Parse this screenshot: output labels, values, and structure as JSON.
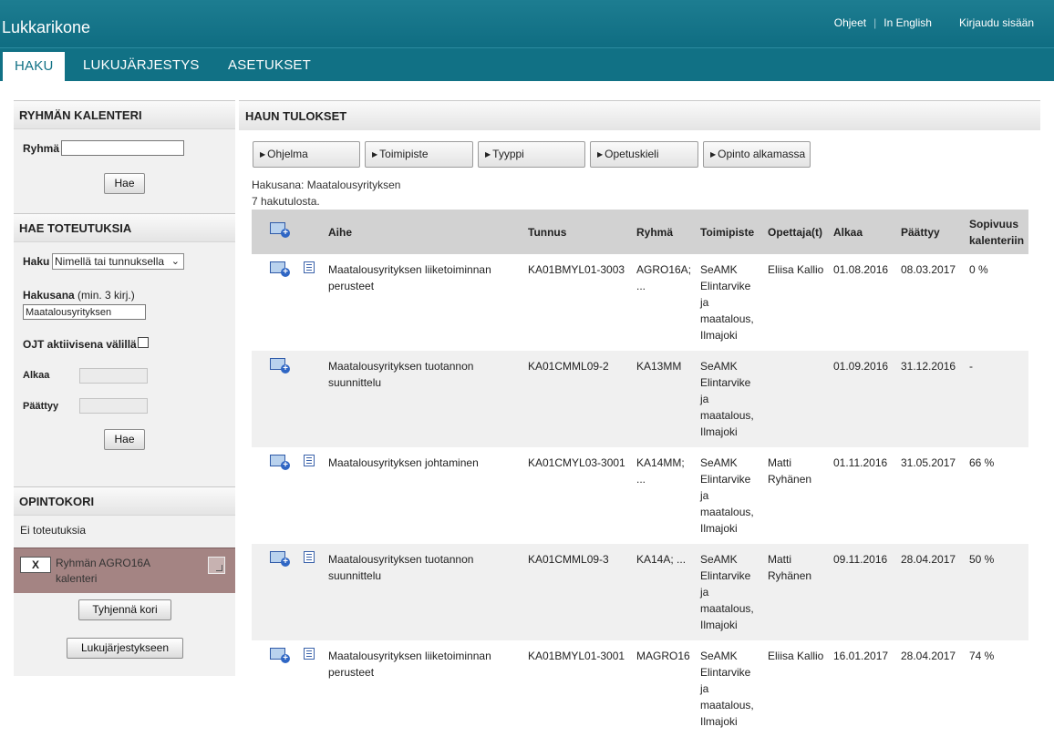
{
  "header": {
    "app_title": "Lukkarikone",
    "links": {
      "help": "Ohjeet",
      "separator": "|",
      "english": "In English",
      "login": "Kirjaudu sisään"
    }
  },
  "tabs": [
    {
      "label": "HAKU",
      "active": true
    },
    {
      "label": "LUKUJÄRJESTYS",
      "active": false
    },
    {
      "label": "ASETUKSET",
      "active": false
    }
  ],
  "sidebar": {
    "group_calendar": {
      "title": "RYHMÄN KALENTERI",
      "group_label": "Ryhmä",
      "group_value": "",
      "search_button": "Hae"
    },
    "find_implementations": {
      "title": "HAE TOTEUTUKSIA",
      "search_label": "Haku",
      "search_mode": "Nimellä tai tunnuksella",
      "query_label": "Hakusana",
      "query_hint": "(min. 3 kirj.)",
      "query_value": "Maatalousyrityksen",
      "ojt_label": "OJT aktiivisena välillä",
      "ojt_checked": false,
      "start_label": "Alkaa",
      "end_label": "Päättyy",
      "search_button": "Hae"
    },
    "cart": {
      "title": "OPINTOKORI",
      "empty_text": "Ei toteutuksia",
      "item_remove": "X",
      "item_label": "Ryhmän AGRO16A kalenteri",
      "clear_button": "Tyhjennä kori",
      "to_schedule_button": "Lukujärjestykseen"
    }
  },
  "results": {
    "title": "HAUN TULOKSET",
    "filters": [
      "Ohjelma",
      "Toimipiste",
      "Tyyppi",
      "Opetuskieli",
      "Opinto alkamassa"
    ],
    "search_term_text": "Hakusana: Maatalousyrityksen",
    "count_text": "7 hakutulosta.",
    "columns": {
      "subject": "Aihe",
      "code": "Tunnus",
      "group": "Ryhmä",
      "location": "Toimipiste",
      "teachers": "Opettaja(t)",
      "start": "Alkaa",
      "end": "Päättyy",
      "fit_line1": "Sopivuus",
      "fit_line2": "kalenteriin"
    },
    "rows": [
      {
        "subject": "Maatalousyrityksen liiketoiminnan perusteet",
        "code": "KA01BMYL01-3003",
        "group": "AGRO16A; ...",
        "location": "SeAMK Elintarvike ja maatalous, Ilmajoki",
        "teachers": "Eliisa Kallio",
        "start": "01.08.2016",
        "end": "08.03.2017",
        "fit": "0 %",
        "has_details": true
      },
      {
        "subject": "Maatalousyrityksen tuotannon suunnittelu",
        "code": "KA01CMML09-2",
        "group": "KA13MM",
        "location": "SeAMK Elintarvike ja maatalous, Ilmajoki",
        "teachers": "",
        "start": "01.09.2016",
        "end": "31.12.2016",
        "fit": "-",
        "has_details": false
      },
      {
        "subject": "Maatalousyrityksen johtaminen",
        "code": "KA01CMYL03-3001",
        "group": "KA14MM; ...",
        "location": "SeAMK Elintarvike ja maatalous, Ilmajoki",
        "teachers": "Matti Ryhänen",
        "start": "01.11.2016",
        "end": "31.05.2017",
        "fit": "66 %",
        "has_details": true
      },
      {
        "subject": "Maatalousyrityksen tuotannon suunnittelu",
        "code": "KA01CMML09-3",
        "group": "KA14A; ...",
        "location": "SeAMK Elintarvike ja maatalous, Ilmajoki",
        "teachers": "Matti Ryhänen",
        "start": "09.11.2016",
        "end": "28.04.2017",
        "fit": "50 %",
        "has_details": true
      },
      {
        "subject": "Maatalousyrityksen liiketoiminnan perusteet",
        "code": "KA01BMYL01-3001",
        "group": "MAGRO16",
        "location": "SeAMK Elintarvike ja maatalous, Ilmajoki",
        "teachers": "Eliisa Kallio",
        "start": "16.01.2017",
        "end": "28.04.2017",
        "fit": "74 %",
        "has_details": true
      }
    ]
  },
  "colors": {
    "brand_teal": "#117185",
    "cart_item_bg": "#a48483",
    "header_gray": "#d2d2d2"
  }
}
